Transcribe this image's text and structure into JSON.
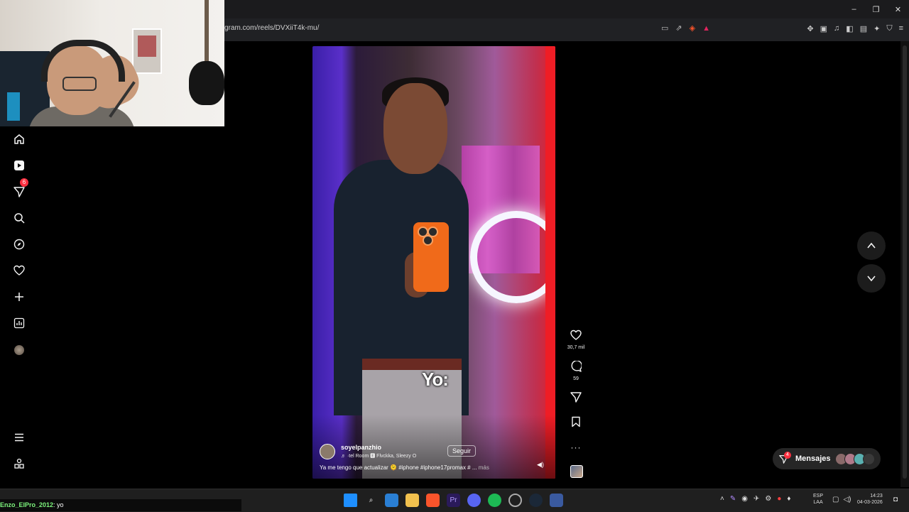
{
  "browser": {
    "url": "gram.com/reels/DVXiiT4k-mu/",
    "window_controls": {
      "minimize": "–",
      "restore": "❐",
      "close": "✕"
    }
  },
  "sidebar": {
    "notifications_badge": "6"
  },
  "reel": {
    "username": "soyelpanzhio",
    "follow_label": "Seguir",
    "music": "♬ ·tel Room 🅴 Flvckka, Sleezy O",
    "caption_overlay": "Yo:",
    "description": "Ya me tengo que actualizar 🫠 #iphone #iphone17promax # ...",
    "more_label": "más",
    "likes": "30,7 mil",
    "comments": "59"
  },
  "messages": {
    "label": "Mensajes",
    "badge": "4"
  },
  "chat": {
    "user": "Enzo_ElPro_2012",
    "text": ": yo"
  },
  "taskbar": {
    "lang_line1": "ESP",
    "lang_line2": "LAA",
    "time": "14:23",
    "date": "04-03-2026"
  },
  "colors": {
    "badge": "#ff3040",
    "page_bg": "#000000",
    "phone": "#f06a1a"
  }
}
